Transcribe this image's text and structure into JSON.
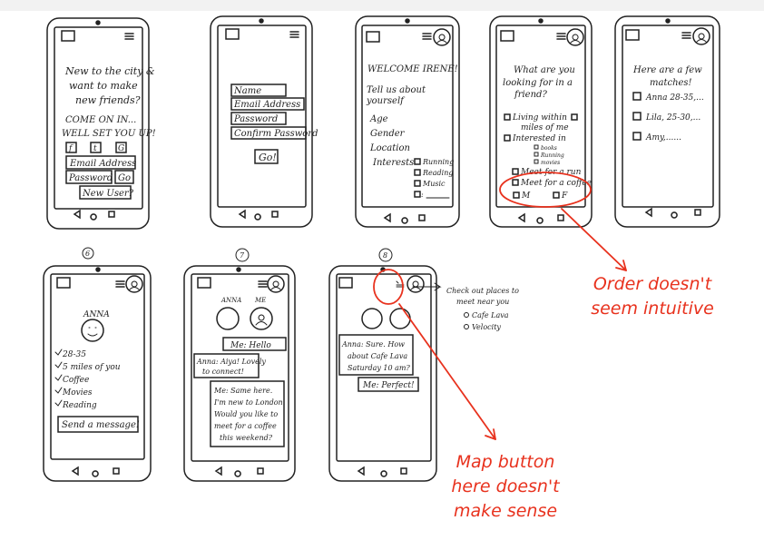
{
  "screens": {
    "s1": {
      "lines": [
        "New to the city &",
        "want to make",
        "new friends?",
        "COME ON IN...",
        "WELL SET YOU UP!"
      ],
      "social": [
        "f",
        "t",
        "G"
      ],
      "email": "Email Address",
      "password": "Password",
      "go": "Go",
      "new_user": "New User?"
    },
    "s2": {
      "fields": [
        "Name",
        "Email Address",
        "Password",
        "Confirm Password"
      ],
      "go": "Go!"
    },
    "s3": {
      "welcome": "WELCOME IRENE!",
      "tell1": "Tell us about",
      "tell2": "yourself",
      "age": "Age",
      "gender": "Gender",
      "location": "Location",
      "interests": "Interests",
      "opts": [
        "Running",
        "Reading",
        "Music",
        ":"
      ]
    },
    "s4": {
      "q1": "What are you",
      "q2": "looking for in a",
      "q3": "friend?",
      "living1": "Living within",
      "living2": "miles of me",
      "interested": "Interested in",
      "subs": [
        "books",
        "Running",
        "movies"
      ],
      "run": "Meet for a run",
      "coffee": "Meet for a coffee",
      "m": "M",
      "f": "F"
    },
    "s5": {
      "h1": "Here are a few",
      "h2": "matches!",
      "rows": [
        "Anna 28-35,...",
        "Lila, 25-30,...",
        "Amy,......"
      ]
    },
    "s6": {
      "num": "6",
      "name": "ANNA",
      "items": [
        "28-35",
        "5 miles of you",
        "Coffee",
        "Movies",
        "Reading"
      ],
      "send": "Send a message!"
    },
    "s7": {
      "num": "7",
      "anna": "ANNA",
      "me": "ME",
      "b1": "Me: Hello",
      "b2a": "Anna: Aiya! Lovely",
      "b2b": "to connect!",
      "b3": [
        "Me: Same here.",
        "I'm new to London.",
        "Would you like to",
        "meet for a coffee",
        "this weekend?"
      ]
    },
    "s8": {
      "num": "8",
      "b1": [
        "Anna: Sure. How",
        "about Cafe Lava",
        "Saturday 10 am?"
      ],
      "b2": "Me: Perfect!",
      "note": [
        "Check out places to",
        "meet near you",
        "Cafe Lava",
        "Velocity"
      ]
    }
  },
  "annotations": {
    "order": [
      "Order doesn't",
      "seem intuitive"
    ],
    "map": [
      "Map button",
      "here doesn't",
      "make sense"
    ],
    "accent": "#e8321e"
  }
}
